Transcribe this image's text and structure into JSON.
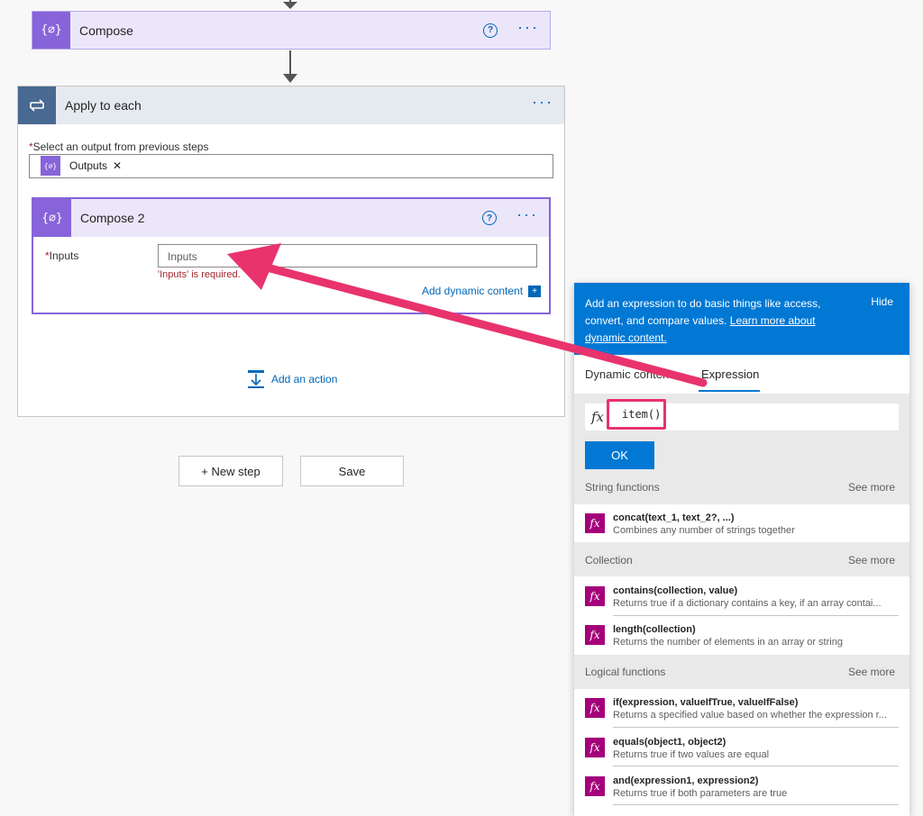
{
  "compose1": {
    "title": "Compose",
    "help": "?",
    "more": "···"
  },
  "apply": {
    "title": "Apply to each",
    "more": "···"
  },
  "select_output": {
    "required_mark": "*",
    "label": "Select an output from previous steps",
    "token": "Outputs",
    "remove": "✕"
  },
  "compose2": {
    "title": "Compose 2",
    "help": "?",
    "more": "···",
    "inputs_required_mark": "*",
    "inputs_label": "Inputs",
    "inputs_placeholder": "Inputs",
    "error": "'Inputs' is required.",
    "add_dynamic": "Add dynamic content"
  },
  "add_action": "Add an action",
  "new_step": "+ New step",
  "save": "Save",
  "panel": {
    "desc_prefix": "Add an expression to do basic things like access, convert, and compare values.",
    "learn_more": "Learn more about dynamic content.",
    "hide": "Hide",
    "tabs": [
      "Dynamic content",
      "Expression"
    ],
    "fx": "fx",
    "expression_value": "item()",
    "ok": "OK",
    "sections": [
      {
        "title": "String functions",
        "see_more": "See more",
        "functions": [
          {
            "name": "concat(text_1, text_2?, ...)",
            "desc": "Combines any number of strings together"
          }
        ]
      },
      {
        "title": "Collection",
        "see_more": "See more",
        "functions": [
          {
            "name": "contains(collection, value)",
            "desc": "Returns true if a dictionary contains a key, if an array contai..."
          },
          {
            "name": "length(collection)",
            "desc": "Returns the number of elements in an array or string"
          }
        ]
      },
      {
        "title": "Logical functions",
        "see_more": "See more",
        "functions": [
          {
            "name": "if(expression, valueIfTrue, valueIfFalse)",
            "desc": "Returns a specified value based on whether the expression r..."
          },
          {
            "name": "equals(object1, object2)",
            "desc": "Returns true if two values are equal"
          },
          {
            "name": "and(expression1, expression2)",
            "desc": "Returns true if both parameters are true"
          }
        ]
      }
    ]
  },
  "colors": {
    "accent": "#0078d4",
    "compose": "#8764d9",
    "function": "#a4007a",
    "highlight": "#e8336d",
    "error": "#a4262c"
  }
}
